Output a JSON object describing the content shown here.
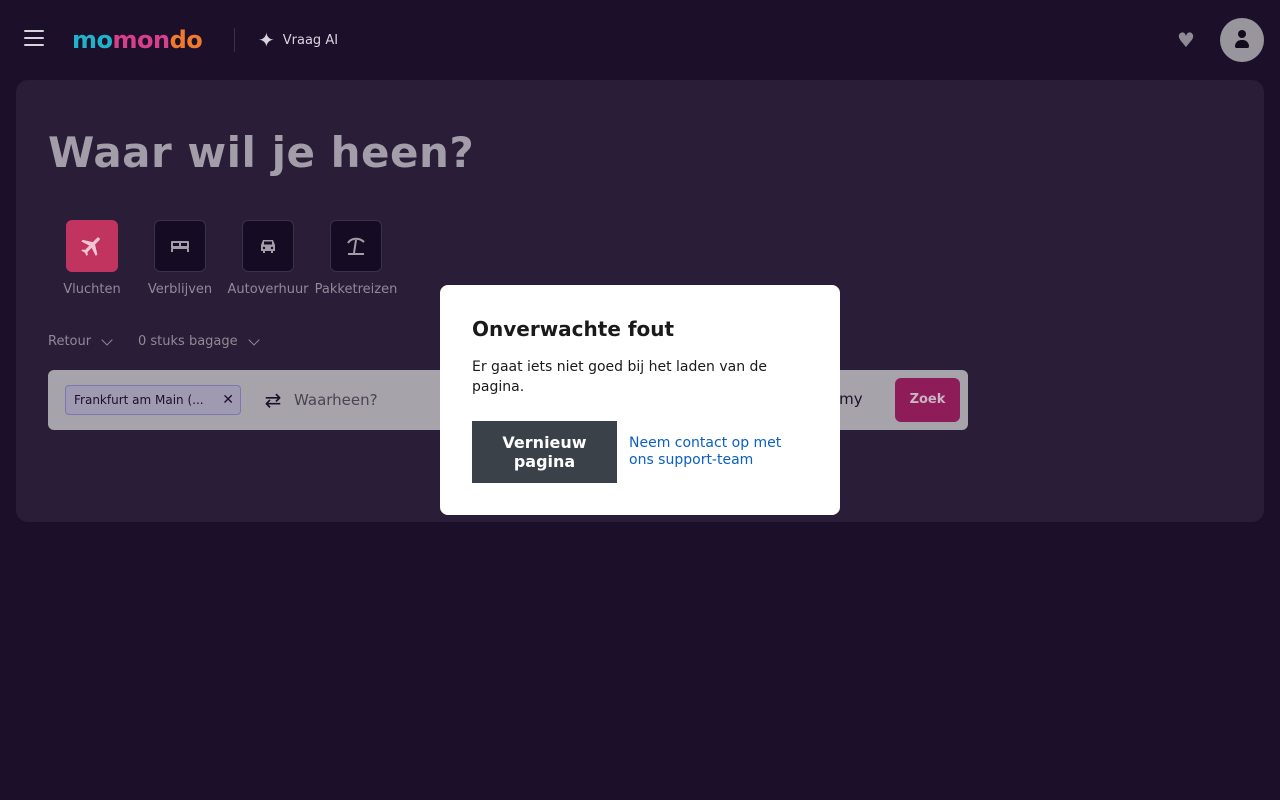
{
  "header": {
    "logo": {
      "part1": "mo",
      "part2": "mon",
      "part3": "do"
    },
    "ai_label": "Vraag AI",
    "icons": {
      "menu": "hamburger-icon",
      "ai": "sparkle-icon",
      "favorites": "heart-icon",
      "account": "user-icon"
    }
  },
  "main": {
    "title": "Waar wil je heen?",
    "tabs": [
      {
        "label": "Vluchten",
        "icon": "plane-icon",
        "active": true
      },
      {
        "label": "Verblijven",
        "icon": "bed-icon",
        "active": false
      },
      {
        "label": "Autoverhuur",
        "icon": "car-icon",
        "active": false
      },
      {
        "label": "Pakketreizen",
        "icon": "beach-umbrella-icon",
        "active": false
      }
    ],
    "trip_type": "Retour",
    "baggage": "0 stuks bagage",
    "search": {
      "origin": "Frankfurt am Main (...",
      "destination_placeholder": "Waarheen?",
      "cabin_partial": "omy",
      "search_label": "Zoek"
    }
  },
  "modal": {
    "title": "Onverwachte fout",
    "message": "Er gaat iets niet goed bij het laden van de pagina.",
    "reload_label": "Vernieuw pagina",
    "support_label": "Neem contact op met ons support-team"
  },
  "colors": {
    "background": "#1b0f2a",
    "panel": "#2a1d38",
    "active_tab": "#c0345f",
    "search_button": "#8e1c59",
    "link": "#0a5fc4"
  }
}
